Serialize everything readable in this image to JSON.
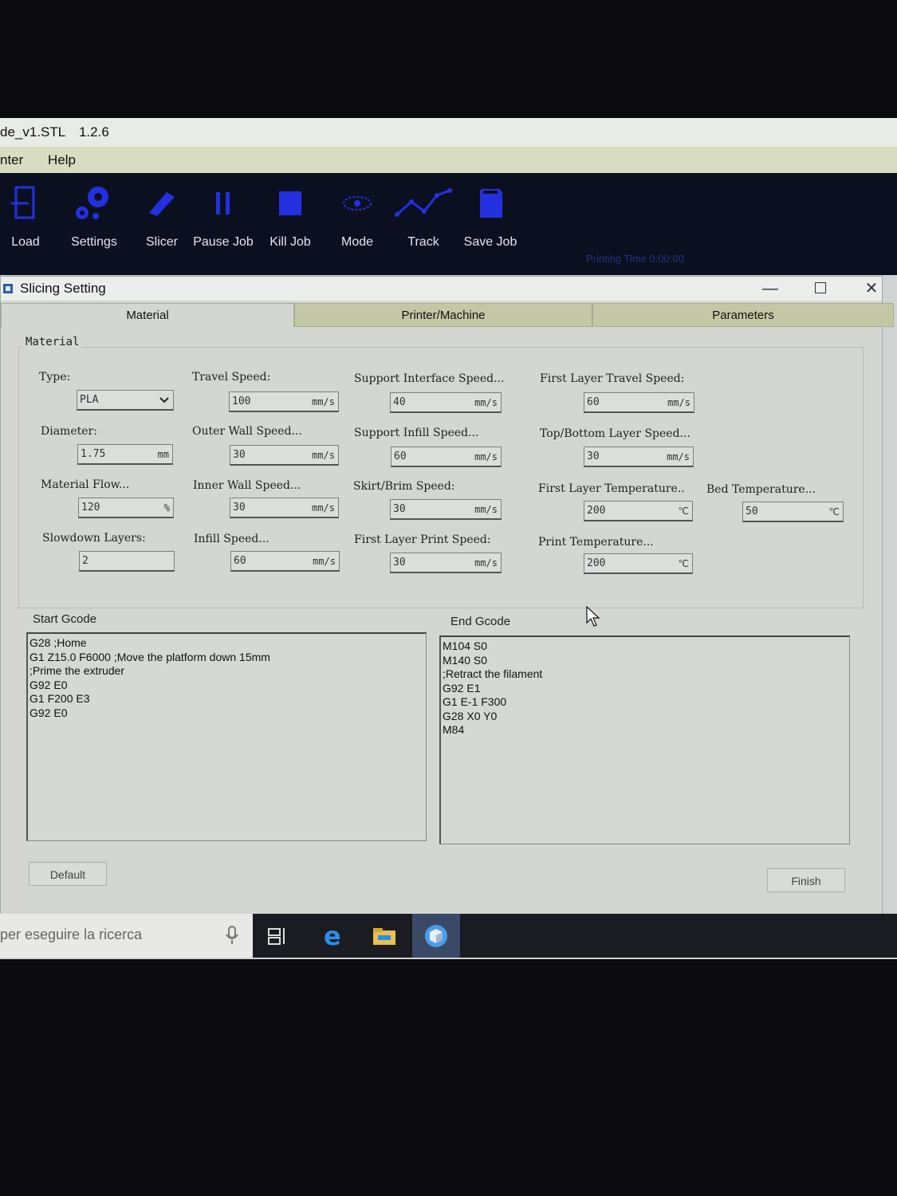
{
  "app": {
    "title": "de_v1.STL",
    "version": "1.2.6"
  },
  "menu": [
    "nter",
    "Help"
  ],
  "toolbar": {
    "items": [
      {
        "label": "Load",
        "icon": "load-icon"
      },
      {
        "label": "Settings",
        "icon": "gears-icon"
      },
      {
        "label": "Slicer",
        "icon": "blade-icon"
      },
      {
        "label": "Pause Job",
        "icon": "pause-icon"
      },
      {
        "label": "Kill Job",
        "icon": "stop-icon"
      },
      {
        "label": "Mode",
        "icon": "eye-icon"
      },
      {
        "label": "Track",
        "icon": "track-icon"
      },
      {
        "label": "Save Job",
        "icon": "sd-card-icon"
      }
    ],
    "print_time": "Printing Time 0:00:00"
  },
  "dialog": {
    "title": "Slicing Setting",
    "tabs": [
      "Material",
      "Printer/Machine",
      "Parameters"
    ],
    "active_tab": "Material",
    "group_title": "Material",
    "fields": {
      "type": {
        "label": "Type:",
        "value": "PLA"
      },
      "diameter": {
        "label": "Diameter:",
        "value": "1.75",
        "unit": "mm"
      },
      "material_flow": {
        "label": "Material Flow...",
        "value": "120",
        "unit": "%"
      },
      "slowdown_layers": {
        "label": "Slowdown Layers:",
        "value": "2"
      },
      "travel_speed": {
        "label": "Travel Speed:",
        "value": "100",
        "unit": "mm/s"
      },
      "outer_wall_speed": {
        "label": "Outer Wall Speed...",
        "value": "30",
        "unit": "mm/s"
      },
      "inner_wall_speed": {
        "label": "Inner Wall Speed...",
        "value": "30",
        "unit": "mm/s"
      },
      "infill_speed": {
        "label": "Infill Speed...",
        "value": "60",
        "unit": "mm/s"
      },
      "support_interface_speed": {
        "label": "Support Interface Speed...",
        "value": "40",
        "unit": "mm/s"
      },
      "support_infill_speed": {
        "label": "Support Infill Speed...",
        "value": "60",
        "unit": "mm/s"
      },
      "skirt_brim_speed": {
        "label": "Skirt/Brim Speed:",
        "value": "30",
        "unit": "mm/s"
      },
      "first_layer_print_speed": {
        "label": "First Layer Print Speed:",
        "value": "30",
        "unit": "mm/s"
      },
      "first_layer_travel_speed": {
        "label": "First Layer Travel Speed:",
        "value": "60",
        "unit": "mm/s"
      },
      "top_bottom_layer_speed": {
        "label": "Top/Bottom Layer Speed...",
        "value": "30",
        "unit": "mm/s"
      },
      "first_layer_temperature": {
        "label": "First Layer Temperature..",
        "value": "200",
        "unit": "℃"
      },
      "print_temperature": {
        "label": "Print Temperature...",
        "value": "200",
        "unit": "℃"
      },
      "bed_temperature": {
        "label": "Bed Temperature...",
        "value": "50",
        "unit": "℃"
      }
    },
    "start_gcode": {
      "title": "Start Gcode",
      "lines": [
        "G28 ;Home",
        "G1 Z15.0 F6000 ;Move the platform down 15mm",
        ";Prime the extruder",
        "G92 E0",
        "G1 F200 E3",
        "G92 E0"
      ]
    },
    "end_gcode": {
      "title": "End Gcode",
      "lines": [
        "M104 S0",
        "M140 S0",
        ";Retract the filament",
        "G92 E1",
        "G1 E-1 F300",
        "G28 X0 Y0",
        "M84"
      ]
    },
    "buttons": {
      "default": "Default",
      "finish": "Finish"
    }
  },
  "taskbar": {
    "search_placeholder": "per eseguire la ricerca"
  },
  "colors": {
    "toolbar_bg": "#0b1020",
    "icon_blue": "#2430e0",
    "tab_inactive": "#c3c7a5",
    "menubar": "#d8dcc0"
  }
}
